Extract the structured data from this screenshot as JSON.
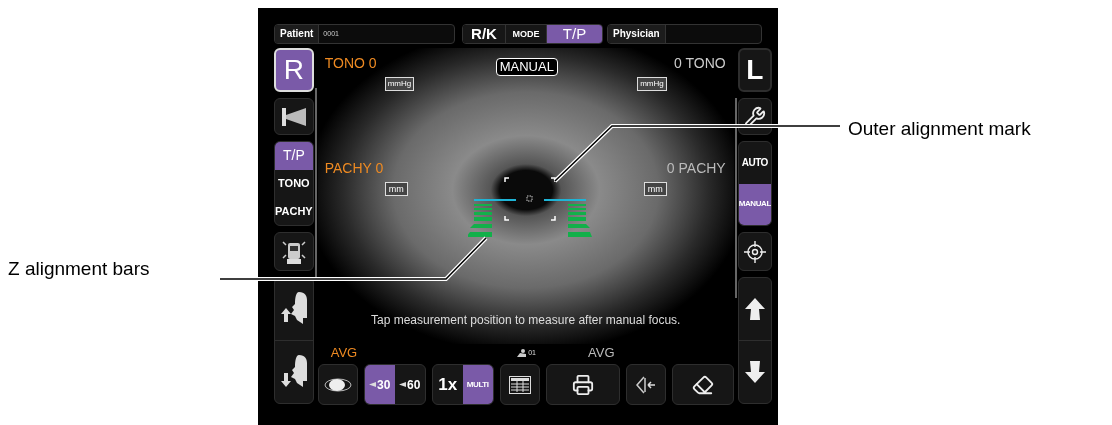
{
  "top_bar": {
    "patient": {
      "label": "Patient",
      "value": "0001"
    },
    "mode": {
      "label": "MODE",
      "options": [
        {
          "label": "R/K",
          "selected": false
        },
        {
          "label": "T/P",
          "selected": true
        }
      ]
    },
    "physician": {
      "label": "Physician"
    }
  },
  "left_column": {
    "eye": {
      "label": "R",
      "selected": true
    },
    "measure_modes": [
      {
        "label": "T/P",
        "selected": true
      },
      {
        "label": "TONO",
        "selected": false
      },
      {
        "label": "PACHY",
        "selected": false
      }
    ]
  },
  "right_column": {
    "eye": {
      "label": "L",
      "selected": false
    },
    "focus_modes": [
      {
        "label": "AUTO",
        "selected": false
      },
      {
        "label": "MANUAL",
        "selected": true
      }
    ]
  },
  "viewer": {
    "status": "MANUAL",
    "right_eye": {
      "tono": {
        "label": "TONO",
        "value": "0",
        "unit": "mmHg"
      },
      "pachy": {
        "label": "PACHY",
        "value": "0",
        "unit": "mm"
      }
    },
    "left_eye": {
      "tono": {
        "label": "TONO",
        "value": "0",
        "unit": "mmHg"
      },
      "pachy": {
        "label": "PACHY",
        "value": "0",
        "unit": "mm"
      }
    },
    "message": "Tap measurement position to measure after manual focus."
  },
  "bottom_bar": {
    "right_avg": "AVG",
    "patient_count": "01",
    "left_avg": "AVG",
    "angles": [
      {
        "label": "30",
        "selected": true
      },
      {
        "label": "60",
        "selected": false
      }
    ],
    "repeat": [
      {
        "label": "1x",
        "selected": false
      },
      {
        "label": "MULTI",
        "selected": true
      }
    ]
  },
  "callouts": [
    {
      "label": "Outer alignment mark"
    },
    {
      "label": "Z alignment bars"
    }
  ]
}
